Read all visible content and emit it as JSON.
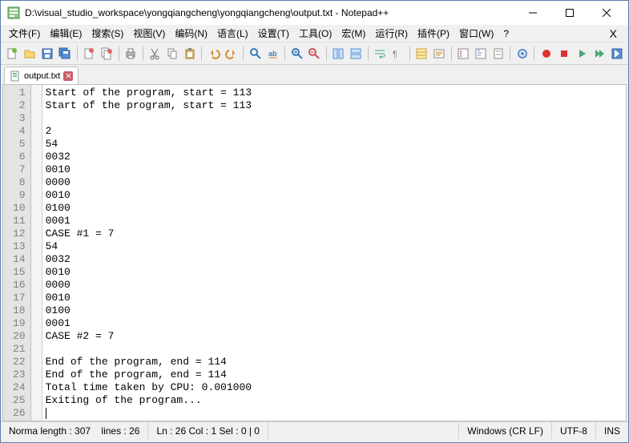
{
  "window": {
    "title": "D:\\visual_studio_workspace\\yongqiangcheng\\yongqiangcheng\\output.txt - Notepad++"
  },
  "menu": {
    "file": "文件(F)",
    "edit": "编辑(E)",
    "search": "搜索(S)",
    "view": "视图(V)",
    "encoding": "编码(N)",
    "language": "语言(L)",
    "settings": "设置(T)",
    "tools": "工具(O)",
    "macro": "宏(M)",
    "run": "运行(R)",
    "plugins": "插件(P)",
    "window": "窗口(W)",
    "help": "?"
  },
  "tab": {
    "name": "output.txt"
  },
  "editor": {
    "lines": [
      "Start of the program, start = 113",
      "Start of the program, start = 113",
      "",
      "2",
      "54",
      "0032",
      "0010",
      "0000",
      "0010",
      "0100",
      "0001",
      "CASE #1 = 7",
      "54",
      "0032",
      "0010",
      "0000",
      "0010",
      "0100",
      "0001",
      "CASE #2 = 7",
      "",
      "End of the program, end = 114",
      "End of the program, end = 114",
      "Total time taken by CPU: 0.001000",
      "Exiting of the program...",
      ""
    ],
    "line_count": 26
  },
  "status": {
    "length": "Norma length : 307",
    "lines": "lines : 26",
    "pos": "Ln : 26    Col : 1    Sel : 0 | 0",
    "eol": "Windows (CR LF)",
    "enc": "UTF-8",
    "mode": "INS"
  }
}
